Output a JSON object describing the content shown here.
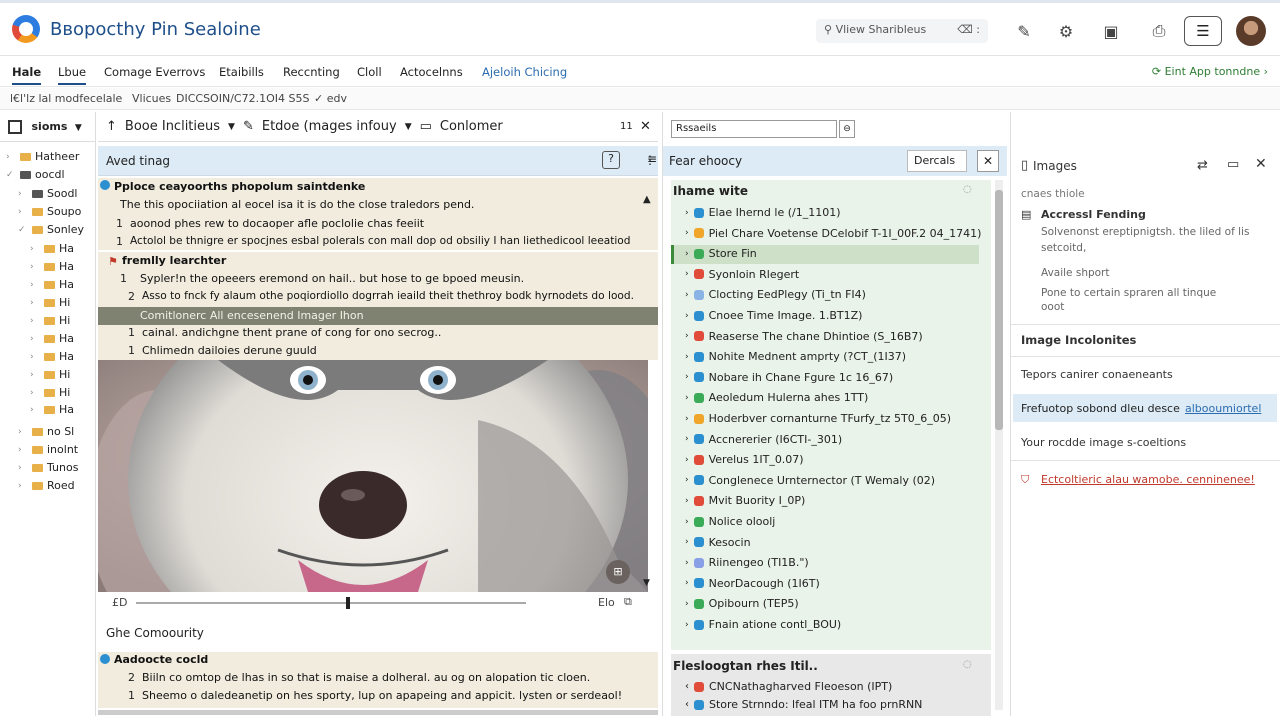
{
  "title_bar": {
    "app_title": "Bвopocthy Pin Sealoine",
    "search_text": "Vliew Sharibleus",
    "search_shortcut": "⌫ :"
  },
  "menubar": {
    "items": [
      "Hale",
      "Lbue",
      "Comage Everrovs",
      "Etaibills",
      "Reccnting",
      "Cloll",
      "Actocelnns",
      "Ajeloih Chicing"
    ],
    "right_action": "Eint App tonndne"
  },
  "subbar": {
    "text_1": "l€l'lz lal modfecelale",
    "text_2": "Vlicues",
    "text_3": "DICCSOIN/C72.1OI4 S5S",
    "text_4": "✓ edv"
  },
  "left_pane": {
    "header": "sioms",
    "tree": [
      {
        "label": "Hatheer",
        "level": 0
      },
      {
        "label": "oocdl",
        "level": 0
      },
      {
        "label": "Soodl",
        "level": 1
      },
      {
        "label": "Soupo",
        "level": 1
      },
      {
        "label": "Sonley",
        "level": 1
      },
      {
        "label": "Ha",
        "level": 2
      },
      {
        "label": "Ha",
        "level": 2
      },
      {
        "label": "Ha",
        "level": 2
      },
      {
        "label": "Hi",
        "level": 2
      },
      {
        "label": "Hi",
        "level": 2
      },
      {
        "label": "Ha",
        "level": 2
      },
      {
        "label": "Ha",
        "level": 2
      },
      {
        "label": "Hi",
        "level": 2
      },
      {
        "label": "Hi",
        "level": 2
      },
      {
        "label": "Ha",
        "level": 2
      },
      {
        "label": "no Sl",
        "level": 1
      },
      {
        "label": "inolnt",
        "level": 1
      },
      {
        "label": "Tunos",
        "level": 1
      },
      {
        "label": "Roed",
        "level": 1
      }
    ]
  },
  "mid_pane": {
    "toolbar": {
      "item_1": "Booe Inclitieus",
      "item_2": "Etdoe (mages infouy",
      "item_3": "Conlomer",
      "counter": "11"
    },
    "panel_title": "Aved tinag",
    "block_1": {
      "heading": "Pploce ceayoorths phopolum saintdenke",
      "lines": [
        "The this opociiation al eocel isa it is do the close traledors pend.",
        "aoonod phes rew to docaoper afle poclolie chas feeiit",
        "Actolol be thnigre er spocjnes esbal polerals con mall dop od obsiliy I han liethedicool leeatiod"
      ]
    },
    "block_2": {
      "heading": "fremlly learchter",
      "lines": [
        "Sypler!n the opeeers eremond on hail.. but hose to ge bpoed meusin.",
        "Asso to fnck fy alaum othe poqiordiollo dogrrah ieaild theit thethroy bodk hyrnodets do lood.",
        "Comitlonerc All encesenend Imager Ihon",
        "cainal. andichgne thent prane of cong for ono secrog..",
        "Chlimedn dailoies derune guuld"
      ],
      "line_numbers": [
        "1",
        "2",
        "",
        "1",
        "1"
      ]
    },
    "scrub": {
      "left": "£D",
      "right": "Elo"
    },
    "lower_title": "Ghe Comoourity",
    "block_3": {
      "heading": "Aadoocte cocld",
      "lines": [
        "Biiln co omtop de lhas in so that is maise a dolheral. au og on alopation tic cloen.",
        "Sheemo o daledeanetip on hes sporty, lup on apapeing and appicit. lysten or serdeaol!"
      ],
      "line_numbers": [
        "2",
        "1"
      ]
    }
  },
  "right_pane": {
    "search_value": "Rssaeils",
    "title": "Fear ehoocy",
    "button": "Dercals",
    "list_header": "Ihame wite",
    "items": [
      {
        "label": "Elae Ihernd le (/1_1101)",
        "color": "#2b8fd0"
      },
      {
        "label": "Piel Chare Voetense DCelobif T-1I_00F.2 04_1741)",
        "color": "#f0a52b"
      },
      {
        "label": "Store Fin",
        "color": "#3bab58",
        "selected": true
      },
      {
        "label": "Syonloin Rlegert",
        "color": "#e04b3a"
      },
      {
        "label": "Clocting EedPlegy (Ti_tn FI4)",
        "color": "#8ab3e6"
      },
      {
        "label": "Cnoee Time Image. 1.BT1Z)",
        "color": "#2b8fd0"
      },
      {
        "label": "Reaserse The chane Dhintioe (S_16B7)",
        "color": "#e04b3a"
      },
      {
        "label": "Nohite Mednent amprty (?CT_(1I37)",
        "color": "#2b8fd0"
      },
      {
        "label": "Nobare ih Chane Fgure 1c 16_67)",
        "color": "#2b8fd0"
      },
      {
        "label": "Aeoledum Hulerna ahes 1TT)",
        "color": "#3bab58"
      },
      {
        "label": "Hoderbver cornanturne TFurfy_tz 5T0_6_05)",
        "color": "#f0a52b"
      },
      {
        "label": "Accnererier (I6CTI-_301)",
        "color": "#2b8fd0"
      },
      {
        "label": "Verelus 1IT_0.07)",
        "color": "#e04b3a"
      },
      {
        "label": "Conglenece Urnternector (T Wemaly (02)",
        "color": "#2b8fd0"
      },
      {
        "label": "Mvit Buority I_0P)",
        "color": "#e04b3a"
      },
      {
        "label": "Nolice oloolj",
        "color": "#3bab58"
      },
      {
        "label": "Kesocin",
        "color": "#2b8fd0"
      },
      {
        "label": "Riinengeo (TI1B.\")",
        "color": "#8aa0e6"
      },
      {
        "label": "NeorDacough (1I6T)",
        "color": "#2b8fd0"
      },
      {
        "label": "Opibourn (TEP5)",
        "color": "#3bab58"
      },
      {
        "label": "Fnain atione contl_BOU)",
        "color": "#2b8fd0"
      }
    ],
    "section_2_header": "Flesloogtan rhes Itil..",
    "section_2_items": [
      {
        "label": "CNCNathagharved Fleoeson (IPT)",
        "color": "#e04b3a"
      },
      {
        "label": "Store Strnndo: lfeal ITM ha foo prnRNN",
        "color": "#2b8fd0"
      }
    ]
  },
  "inspector": {
    "title": "Images",
    "subtitle": "cnaes thiole",
    "card_title": "Accressl Fending",
    "card_desc_1": "Solvenonst ereptipnigtsh. the liled of lis",
    "card_desc_2": "setcoitd,",
    "avail_label": "Availe shport",
    "avail_desc_1": "Pone to certain spraren all tinque",
    "avail_desc_2": "ooot",
    "section_1": "Image Incolonites",
    "row_1": "Tepors canirer conaeneants",
    "row_2_text": "Frefuotop sobond dleu desce",
    "row_2_link": "albooumiortel",
    "row_3": "Your rocdde image s-coeltions",
    "warning": "Ectcoltieric alau wamobe. cenninenee!",
    "accent": "#c0392b"
  }
}
